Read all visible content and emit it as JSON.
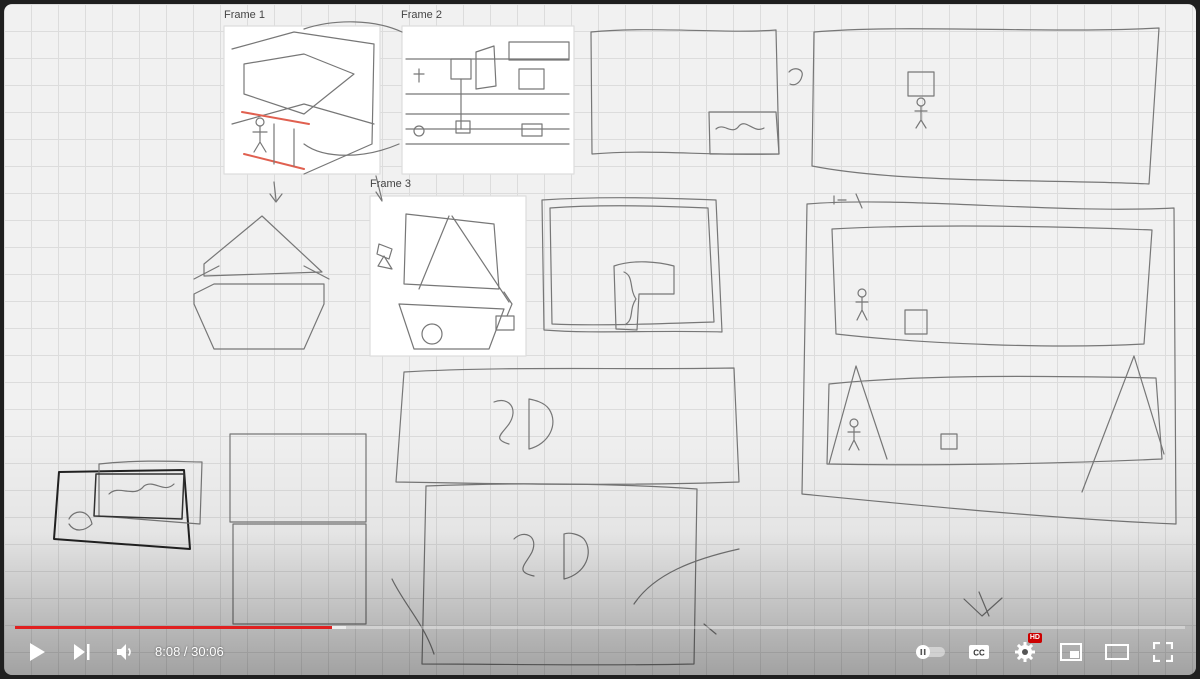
{
  "canvas": {
    "frames": [
      {
        "label": "Frame 1"
      },
      {
        "label": "Frame 2"
      },
      {
        "label": "Frame 3"
      }
    ]
  },
  "player": {
    "current_time": "8:08",
    "duration": "30:06",
    "time_separator": " / ",
    "progress_played_fraction": 0.271,
    "progress_loaded_fraction": 0.283,
    "hd_badge": "HD",
    "accent_color": "#e02020"
  },
  "icons": {
    "play": "play-icon",
    "next": "next-icon",
    "volume": "volume-icon",
    "autoplay": "autoplay-toggle-icon",
    "captions": "captions-icon",
    "settings": "gear-icon",
    "miniplayer": "miniplayer-icon",
    "theater": "theater-mode-icon",
    "fullscreen": "fullscreen-icon"
  }
}
